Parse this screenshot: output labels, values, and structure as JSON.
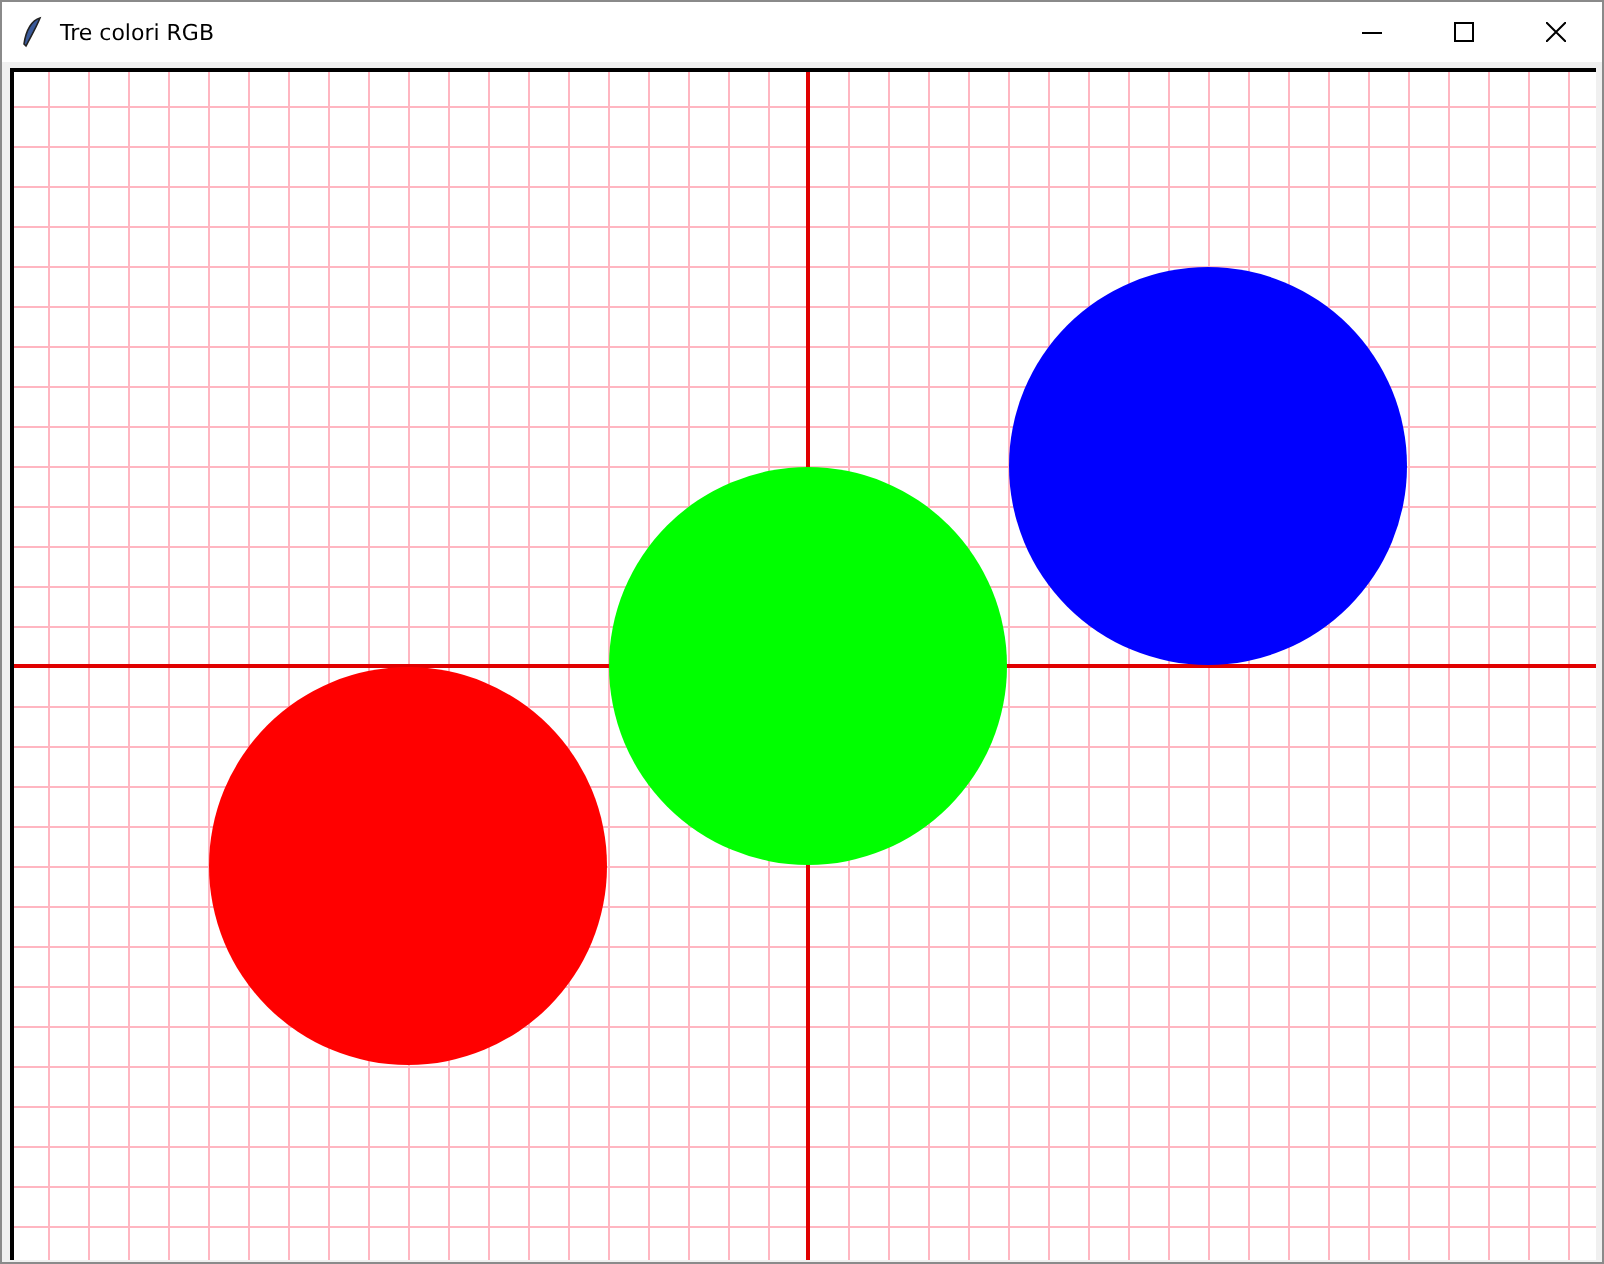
{
  "window": {
    "title": "Tre colori RGB"
  },
  "canvas": {
    "circles": [
      {
        "kind": "circle",
        "color": "#ff0000"
      },
      {
        "kind": "circle",
        "color": "#00ff00"
      },
      {
        "kind": "circle",
        "color": "#0000ff"
      }
    ]
  }
}
